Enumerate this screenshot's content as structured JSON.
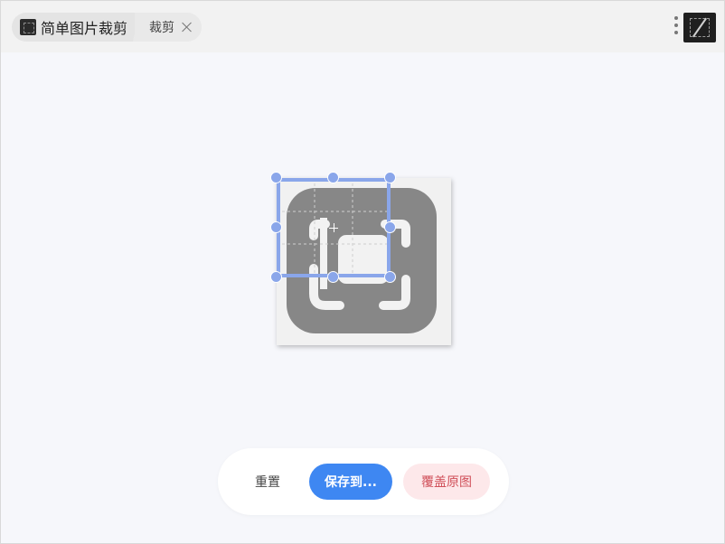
{
  "header": {
    "app_title": "简单图片裁剪",
    "tab_label": "裁剪",
    "app_icon": "crop-app-icon",
    "more_icon": "vertical-dots-icon",
    "close_icon": "close-icon"
  },
  "toolbar": {
    "reset_label": "重置",
    "save_label": "保存到...",
    "overwrite_label": "覆盖原图"
  },
  "colors": {
    "accent": "#3e87f2",
    "crop_handle": "#8aa6ea",
    "danger_text": "#d0505a",
    "danger_bg": "#fde8ea",
    "image_icon": "#878787"
  }
}
